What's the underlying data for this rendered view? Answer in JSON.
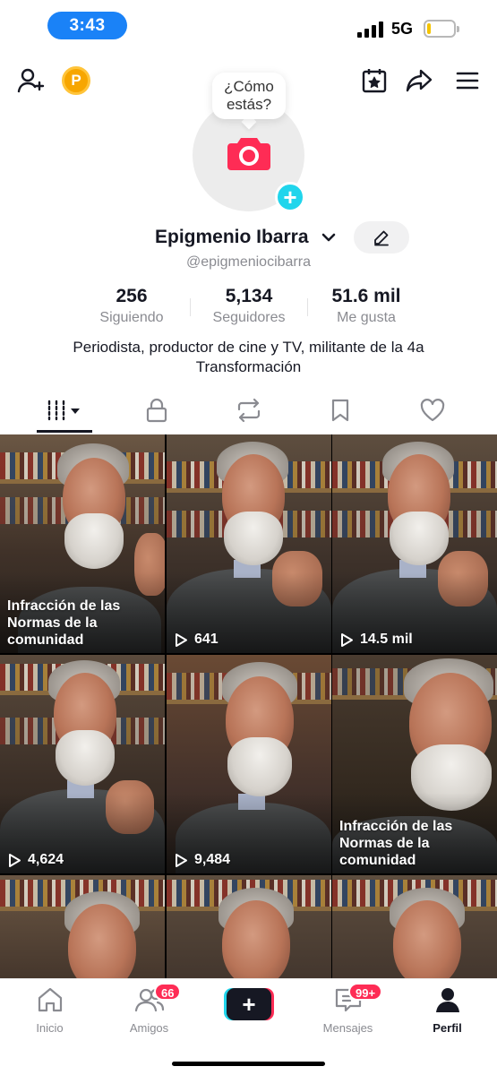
{
  "status_bar": {
    "time": "3:43",
    "network": "5G"
  },
  "header": {
    "coins_label": "P"
  },
  "profile": {
    "bubble_text": "¿Cómo estás?",
    "name": "Epigmenio Ibarra",
    "handle": "@epigmeniocibarra",
    "bio": "Periodista, productor de cine y TV, militante de la 4a Transformación"
  },
  "stats": [
    {
      "value": "256",
      "label": "Siguiendo"
    },
    {
      "value": "5,134",
      "label": "Seguidores"
    },
    {
      "value": "51.6 mil",
      "label": "Me gusta"
    }
  ],
  "tabs": [
    "videos-icon",
    "lock-icon",
    "repost-icon",
    "bookmark-icon",
    "heart-icon"
  ],
  "videos": [
    {
      "kind": "violation",
      "text": "Infracción de las Normas de la comunidad"
    },
    {
      "kind": "views",
      "text": "641"
    },
    {
      "kind": "views",
      "text": "14.5 mil"
    },
    {
      "kind": "views",
      "text": "4,624"
    },
    {
      "kind": "views",
      "text": "9,484"
    },
    {
      "kind": "violation",
      "text": "Infracción de las Normas de la comunidad"
    },
    {
      "kind": "none",
      "text": ""
    },
    {
      "kind": "none",
      "text": ""
    },
    {
      "kind": "none",
      "text": ""
    }
  ],
  "bottom_nav": {
    "home": "Inicio",
    "friends": "Amigos",
    "friends_badge": "66",
    "create": "+",
    "inbox": "Mensajes",
    "inbox_badge": "99+",
    "profile": "Perfil"
  },
  "colors": {
    "accent_cyan": "#20d5ec",
    "accent_red": "#fe2c55",
    "status_pill": "#1a82f7"
  }
}
